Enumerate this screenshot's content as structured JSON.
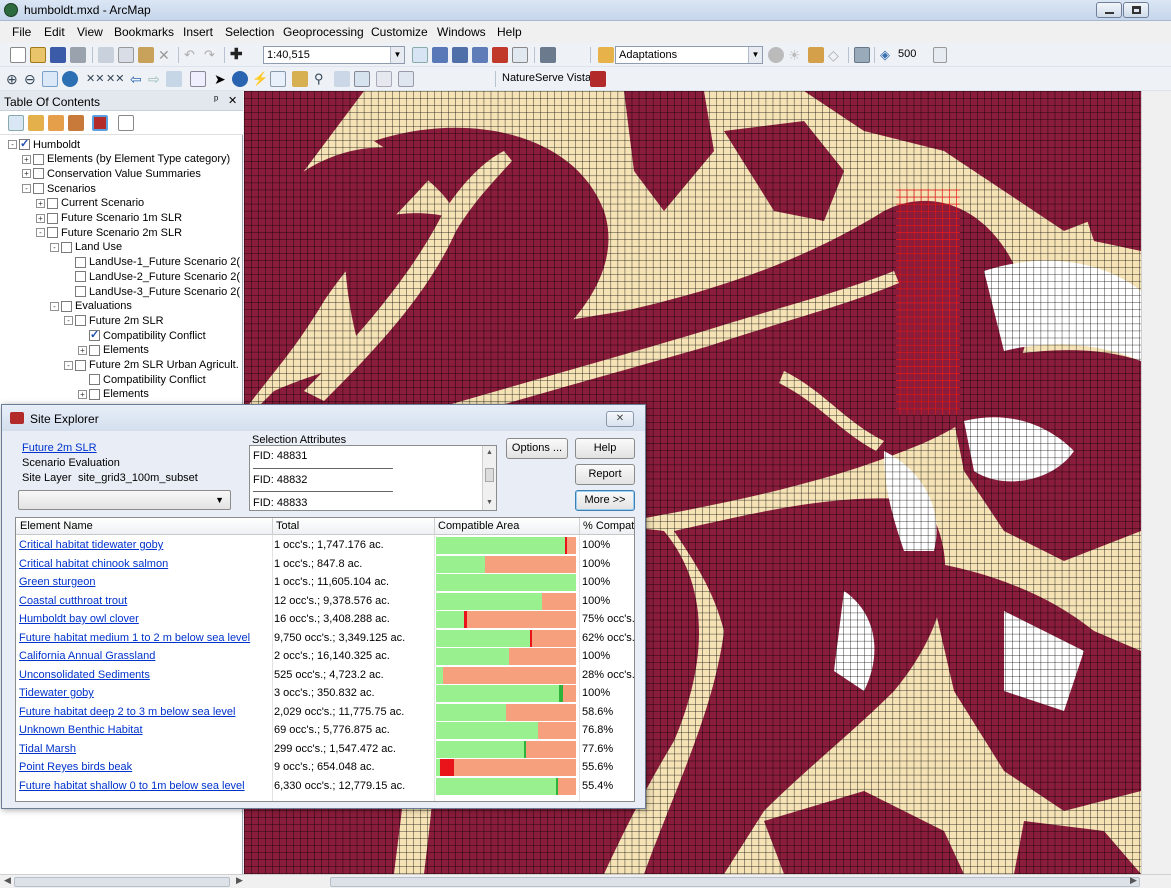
{
  "window": {
    "title": "humboldt.mxd - ArcMap"
  },
  "menu": [
    "File",
    "Edit",
    "View",
    "Bookmarks",
    "Insert",
    "Selection",
    "Geoprocessing",
    "Customize",
    "Windows",
    "Help"
  ],
  "toolbar": {
    "scale": "1:40,515",
    "layer_combo": "Adaptations",
    "value_combo": "500",
    "nsv_label": "NatureServe Vista"
  },
  "toc": {
    "title": "Table Of Contents",
    "pin": "ᵖ",
    "close": "✕",
    "tree": [
      {
        "label": "Humboldt",
        "level": 0,
        "checked": true,
        "expand": "-"
      },
      {
        "label": "Elements (by Element Type category)",
        "level": 1,
        "checked": false,
        "expand": "+"
      },
      {
        "label": "Conservation Value Summaries",
        "level": 1,
        "checked": false,
        "expand": "+"
      },
      {
        "label": "Scenarios",
        "level": 1,
        "checked": false,
        "expand": "-"
      },
      {
        "label": "Current Scenario",
        "level": 2,
        "checked": false,
        "expand": "+"
      },
      {
        "label": "Future Scenario 1m SLR",
        "level": 2,
        "checked": false,
        "expand": "+"
      },
      {
        "label": "Future Scenario 2m SLR",
        "level": 2,
        "checked": false,
        "expand": "-"
      },
      {
        "label": "Land Use",
        "level": 3,
        "checked": false,
        "expand": "-"
      },
      {
        "label": "LandUse-1_Future Scenario 2(",
        "level": 4,
        "checked": false,
        "expand": ""
      },
      {
        "label": "LandUse-2_Future Scenario 2(",
        "level": 4,
        "checked": false,
        "expand": ""
      },
      {
        "label": "LandUse-3_Future Scenario 2(",
        "level": 4,
        "checked": false,
        "expand": ""
      },
      {
        "label": "Evaluations",
        "level": 3,
        "checked": false,
        "expand": "-"
      },
      {
        "label": "Future 2m SLR",
        "level": 4,
        "checked": false,
        "expand": "-"
      },
      {
        "label": "Compatibility Conflict",
        "level": 5,
        "checked": true,
        "expand": ""
      },
      {
        "label": "Elements",
        "level": 5,
        "checked": false,
        "expand": "+"
      },
      {
        "label": "Future 2m SLR Urban Agricult.",
        "level": 4,
        "checked": false,
        "expand": "-"
      },
      {
        "label": "Compatibility Conflict",
        "level": 5,
        "checked": false,
        "expand": ""
      },
      {
        "label": "Elements",
        "level": 5,
        "checked": false,
        "expand": "+"
      }
    ]
  },
  "site_explorer": {
    "title": "Site Explorer",
    "close": "✕",
    "evaluation_link": "Future 2m SLR",
    "evaluation_type": "Scenario Evaluation",
    "site_layer_label": "Site Layer",
    "site_layer_value": "site_grid3_100m_subset",
    "attributes_label": "Selection Attributes",
    "fids": [
      "FID:  48831",
      "FID:  48832",
      "FID:  48833"
    ],
    "buttons": {
      "options": "Options ...",
      "help": "Help",
      "report": "Report",
      "more": "More >>"
    },
    "columns": [
      "Element Name",
      "Total",
      "Compatible Area",
      "% Compat"
    ],
    "rows": [
      {
        "name": "Critical habitat tidewater goby",
        "total": "1 occ's.; 1,747.176 ac.",
        "pct": "100%",
        "compatible": 0.92,
        "red": 0.015
      },
      {
        "name": "Critical habitat chinook salmon",
        "total": "1 occ's.; 847.8 ac.",
        "pct": "100%",
        "compatible": 0.35,
        "red": 0
      },
      {
        "name": "Green sturgeon",
        "total": "1 occ's.; 11,605.104 ac.",
        "pct": "100%",
        "compatible": 1.0,
        "red": 0
      },
      {
        "name": "Coastal cutthroat trout",
        "total": "12 occ's.; 9,378.576 ac.",
        "pct": "100%",
        "compatible": 0.76,
        "red": 0
      },
      {
        "name": "Humboldt bay owl clover",
        "total": "16 occ's.; 3,408.288 ac.",
        "pct": "75% occ's.;",
        "compatible": 0.2,
        "red": 0.02
      },
      {
        "name": "Future habitat medium 1 to 2 m below sea level",
        "total": "9,750 occ's.; 3,349.125 ac.",
        "pct": "62% occ's.;",
        "compatible": 0.67,
        "red": 0.015
      },
      {
        "name": "California Annual Grassland",
        "total": "2 occ's.; 16,140.325 ac.",
        "pct": "100%",
        "compatible": 0.52,
        "red": 0
      },
      {
        "name": "Unconsolidated Sediments",
        "total": "525 occ's.; 4,723.2 ac.",
        "pct": "28% occ's.;",
        "compatible": 0.05,
        "red": 0
      },
      {
        "name": "Tidewater goby",
        "total": "3 occ's.; 350.832 ac.",
        "pct": "100%",
        "compatible": 0.88,
        "red": 0,
        "darkgreen": 0.03
      },
      {
        "name": "Future habitat deep 2 to 3 m below sea level",
        "total": "2,029 occ's.; 11,775.75 ac.",
        "pct": "58.6%",
        "compatible": 0.5,
        "red": 0
      },
      {
        "name": "Unknown Benthic Habitat",
        "total": "69 occ's.; 5,776.875 ac.",
        "pct": "76.8%",
        "compatible": 0.73,
        "red": 0
      },
      {
        "name": "Tidal Marsh",
        "total": "299 occ's.; 1,547.472 ac.",
        "pct": "77.6%",
        "compatible": 0.63,
        "red": 0,
        "thin": true
      },
      {
        "name": "Point Reyes birds beak",
        "total": "9 occ's.; 654.048 ac.",
        "pct": "55.6%",
        "compatible": 0.03,
        "red": 0.1
      },
      {
        "name": "Future habitat shallow 0 to 1m below sea level",
        "total": "6,330 occ's.; 12,779.15 ac.",
        "pct": "55.4%",
        "compatible": 0.86,
        "red": 0,
        "thin": true
      }
    ]
  }
}
